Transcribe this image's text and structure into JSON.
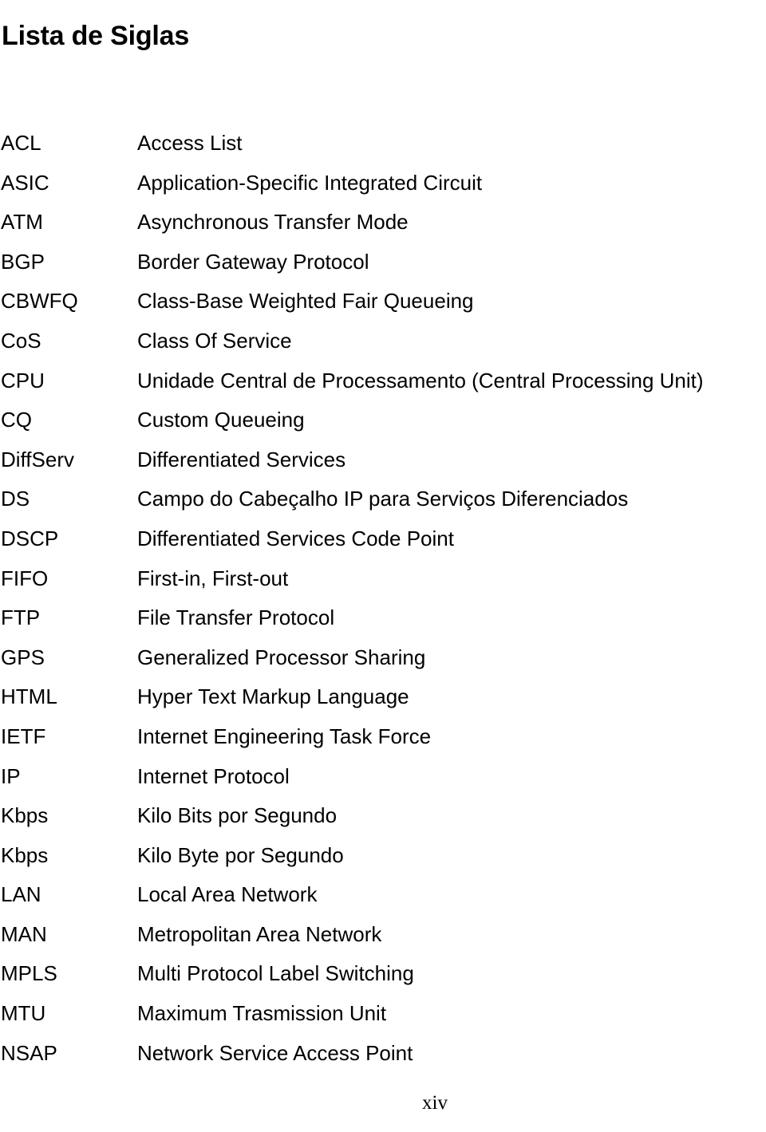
{
  "document": {
    "title": "Lista de Siglas",
    "page_number": "xiv"
  },
  "acronyms": [
    {
      "term": "ACL",
      "definition": "Access List"
    },
    {
      "term": "ASIC",
      "definition": "Application-Specific Integrated Circuit"
    },
    {
      "term": "ATM",
      "definition": "Asynchronous Transfer Mode"
    },
    {
      "term": "BGP",
      "definition": "Border Gateway Protocol"
    },
    {
      "term": "CBWFQ",
      "definition": "Class-Base Weighted Fair Queueing"
    },
    {
      "term": "CoS",
      "definition": "Class Of Service"
    },
    {
      "term": "CPU",
      "definition": "Unidade Central de Processamento (Central Processing Unit)"
    },
    {
      "term": "CQ",
      "definition": "Custom Queueing"
    },
    {
      "term": "DiffServ",
      "definition": "Differentiated Services"
    },
    {
      "term": "DS",
      "definition": "Campo do Cabeçalho IP para Serviços Diferenciados"
    },
    {
      "term": "DSCP",
      "definition": "Differentiated Services Code Point"
    },
    {
      "term": "FIFO",
      "definition": "First-in, First-out"
    },
    {
      "term": "FTP",
      "definition": "File Transfer Protocol"
    },
    {
      "term": "GPS",
      "definition": "Generalized Processor Sharing"
    },
    {
      "term": "HTML",
      "definition": "Hyper Text Markup Language"
    },
    {
      "term": "IETF",
      "definition": "Internet Engineering Task Force"
    },
    {
      "term": "IP",
      "definition": "Internet Protocol"
    },
    {
      "term": "Kbps",
      "definition": "Kilo Bits por Segundo"
    },
    {
      "term": "Kbps",
      "definition": "Kilo Byte por Segundo"
    },
    {
      "term": "LAN",
      "definition": "Local Area Network"
    },
    {
      "term": "MAN",
      "definition": "Metropolitan Area Network"
    },
    {
      "term": "MPLS",
      "definition": "Multi Protocol Label Switching"
    },
    {
      "term": "MTU",
      "definition": "Maximum Trasmission Unit"
    },
    {
      "term": "NSAP",
      "definition": "Network Service Access Point"
    }
  ]
}
